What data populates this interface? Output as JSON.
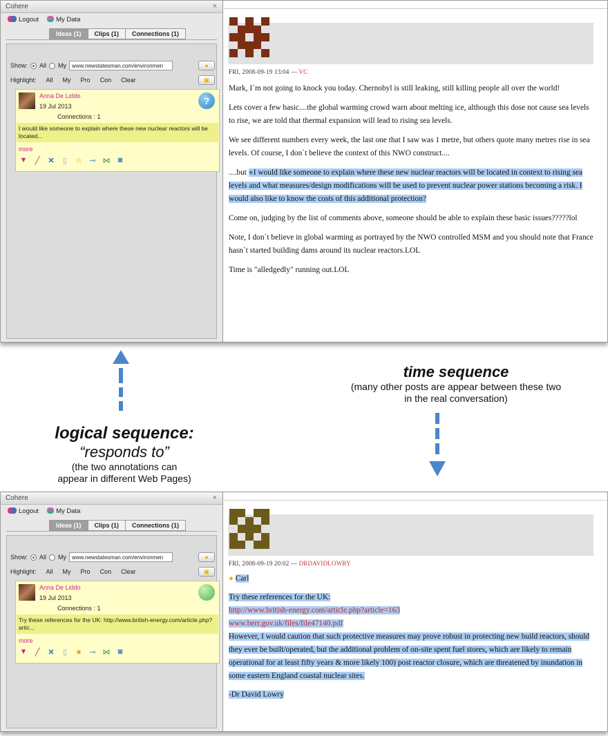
{
  "sidebar": {
    "title": "Cohere",
    "close_glyph": "×",
    "logout": "Logout",
    "my_data": "My Data",
    "tabs": [
      "Ideas (1)",
      "Clips (1)",
      "Connections (1)"
    ],
    "show_label": "Show:",
    "show_all": "All",
    "show_my": "My",
    "url_value": "www.newstatesman.com/environmen",
    "highlight_label": "Highlight:",
    "highlight_options": [
      "All",
      "My",
      "Pro",
      "Con",
      "Clear"
    ],
    "icons": {
      "logout": "logout-icon",
      "mydata": "user-icon",
      "idea_button": "lightbulb-icon",
      "clip_button": "clip-icon"
    }
  },
  "top": {
    "card": {
      "author": "Anna De Liddo",
      "date": "19 Jul 2013",
      "connections": "Connections : 1",
      "excerpt": "I would like someone to explain where these new nuclear reactors will be located...",
      "more": "more",
      "badge": "?",
      "badge_color": "#2f88c8"
    },
    "post": {
      "meta_date": "FRI, 2008-09-19 13:04 — ",
      "meta_author": "VC",
      "paragraphs": [
        "Mark, I`m not going to knock you today. Chernobyl is still leaking, still killing people all over the world!",
        "Lets cover a few basic....the global warming crowd warn about melting ice, although this dose not cause sea levels to rise, we are told that thermal expansion will lead to rising sea levels.",
        "We see different numbers every week, the last one that I saw was 1 metre, but others quote many metres rise in sea levels. Of course, I don`t believe the context of this NWO construct....",
        "Come on, judging by the list of comments above, someone should be able to explain these basic issues?????lol",
        "Note, I don`t believe in global warming as portrayed by the NWO controlled MSM and you should note that France hasn`t started building dams around its nuclear reactors.LOL",
        "Time is \"alledgedly\" running out.LOL"
      ],
      "quote_prefix": "....but ",
      "quote_text": "I would like someone to explain where these new nuclear reactors will be located in context to rising sea levels and what measures/design modifications will be used to prevent nuclear power stations becoming a risk. I would also like to know the costs of this additional protection?",
      "identicon_color": "#7a2e14"
    }
  },
  "bottom": {
    "card": {
      "author": "Anna De Liddo",
      "date": "19 Jul 2013",
      "connections": "Connections : 1",
      "excerpt": "Try these references for the UK: http://www.british-energy.com/article.php?artic...",
      "more": "more",
      "badge": "",
      "badge_color": "#67c06a"
    },
    "post": {
      "meta_date": "FRI, 2008-09-19 20:02 — ",
      "meta_author": "DRDAVIDLOWRY",
      "salutation": "Carl",
      "intro": "Try these references for the UK:",
      "link1": "http://www.british-energy.com/article.php?article=163",
      "link2": "www.berr.gov.uk/files/file47140.pdf",
      "body": "However, I would caution that such protective measures may prove robust in protecting new build reactors, should they ever be built/operated, but the additional problem of on-site spent fuel stores, which are likely to remain operational for at least fifty years & more likely 100) post reactor closure, which are threatened by inundation in some eastern England coastal nuclear sites.",
      "signature": "-Dr David Lowry",
      "identicon_color": "#6b5a1a"
    }
  },
  "annotations": {
    "time_title": "time sequence",
    "time_note_line1": "(many other posts are appear between these two",
    "time_note_line2": "in the real conversation)",
    "logic_title": "logical sequence:",
    "logic_sub": "“responds to”",
    "logic_note_line1": "(the two annotations can",
    "logic_note_line2": "appear in different Web Pages)",
    "arrow_color": "#4a86c8"
  }
}
